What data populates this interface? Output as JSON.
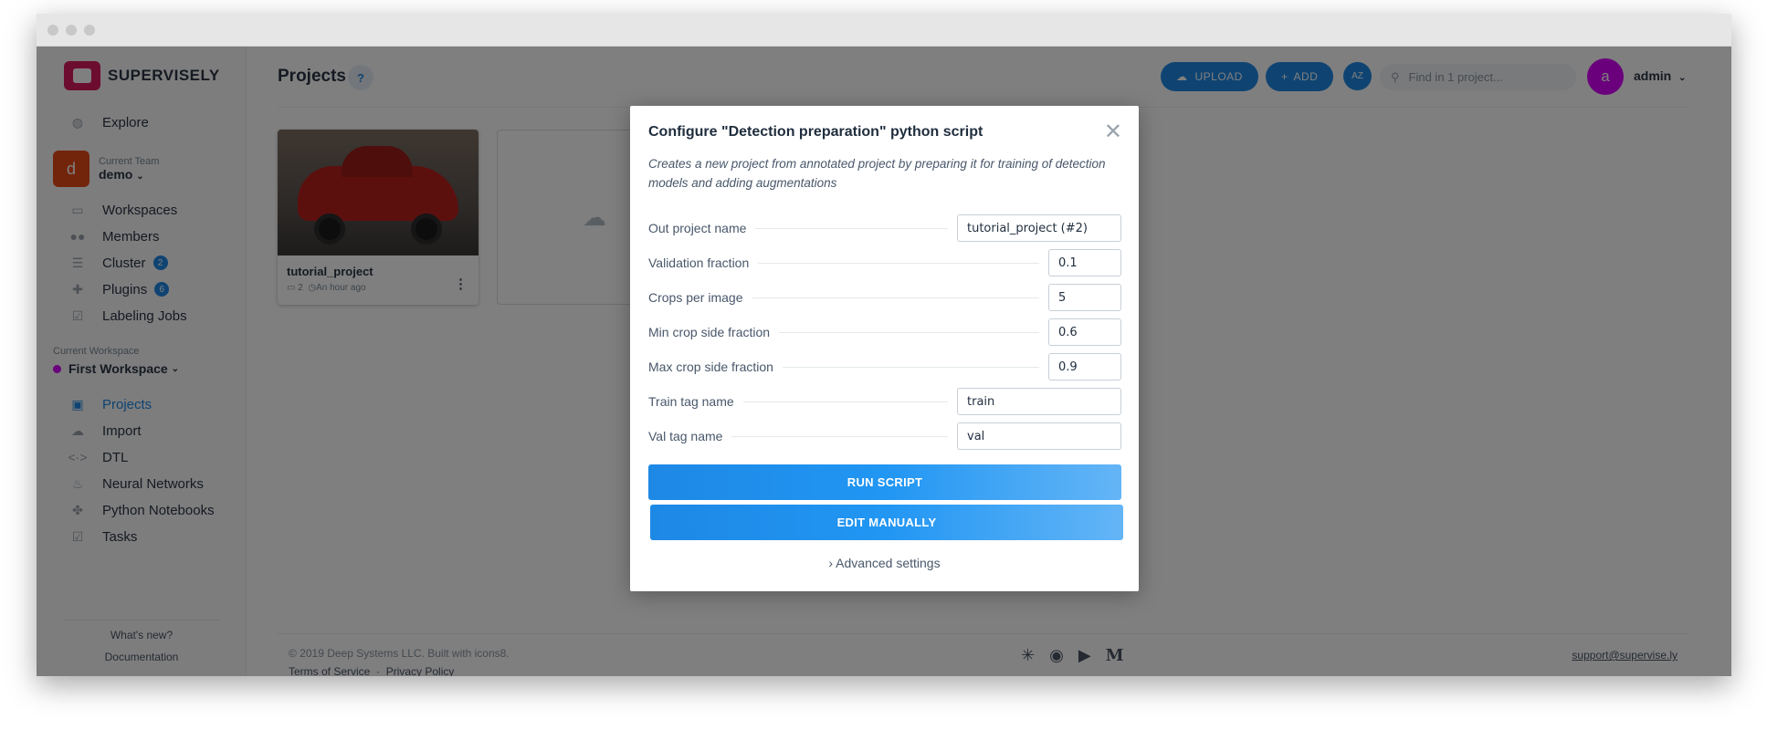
{
  "brand": {
    "name": "SUPERVISELY"
  },
  "sidebar": {
    "explore": "Explore",
    "team": {
      "label": "Current Team",
      "name": "demo",
      "initial": "d"
    },
    "team_items": [
      {
        "label": "Workspaces",
        "icon": "monitor-icon"
      },
      {
        "label": "Members",
        "icon": "members-icon"
      },
      {
        "label": "Cluster",
        "icon": "cluster-icon",
        "badge": "2"
      },
      {
        "label": "Plugins",
        "icon": "puzzle-icon",
        "badge": "6"
      },
      {
        "label": "Labeling Jobs",
        "icon": "checkbox-icon"
      }
    ],
    "workspace": {
      "label": "Current Workspace",
      "name": "First Workspace"
    },
    "workspace_items": [
      {
        "label": "Projects",
        "icon": "images-icon",
        "active": true
      },
      {
        "label": "Import",
        "icon": "cloud-icon"
      },
      {
        "label": "DTL",
        "icon": "code-icon"
      },
      {
        "label": "Neural Networks",
        "icon": "flame-icon"
      },
      {
        "label": "Python Notebooks",
        "icon": "python-icon"
      },
      {
        "label": "Tasks",
        "icon": "checkbox-icon"
      }
    ],
    "whats_new": "What's new?",
    "documentation": "Documentation"
  },
  "header": {
    "title": "Projects",
    "help": "?",
    "upload": "UPLOAD",
    "add": "ADD",
    "sort": "AZ",
    "search_placeholder": "Find in 1 project...",
    "user_initial": "a",
    "user_name": "admin"
  },
  "projects": [
    {
      "name": "tutorial_project",
      "meta_count": "2",
      "meta_time": "An hour ago"
    }
  ],
  "footer": {
    "copyright": "© 2019 Deep Systems LLC. Built with icons8.",
    "terms": "Terms of Service",
    "privacy": "Privacy Policy",
    "support": "support@supervise.ly"
  },
  "dialog": {
    "title": "Configure \"Detection preparation\" python script",
    "description": "Creates a new project from annotated project by preparing it for training of detection models and adding augmentations",
    "fields": [
      {
        "label": "Out project name",
        "value": "tutorial_project (#2)"
      },
      {
        "label": "Validation fraction",
        "value": "0.1"
      },
      {
        "label": "Crops per image",
        "value": "5"
      },
      {
        "label": "Min crop side fraction",
        "value": "0.6"
      },
      {
        "label": "Max crop side fraction",
        "value": "0.9"
      },
      {
        "label": "Train tag name",
        "value": "train"
      },
      {
        "label": "Val tag name",
        "value": "val"
      }
    ],
    "run_button": "RUN SCRIPT",
    "edit_button": "EDIT MANUALLY",
    "advanced": "› Advanced settings"
  }
}
